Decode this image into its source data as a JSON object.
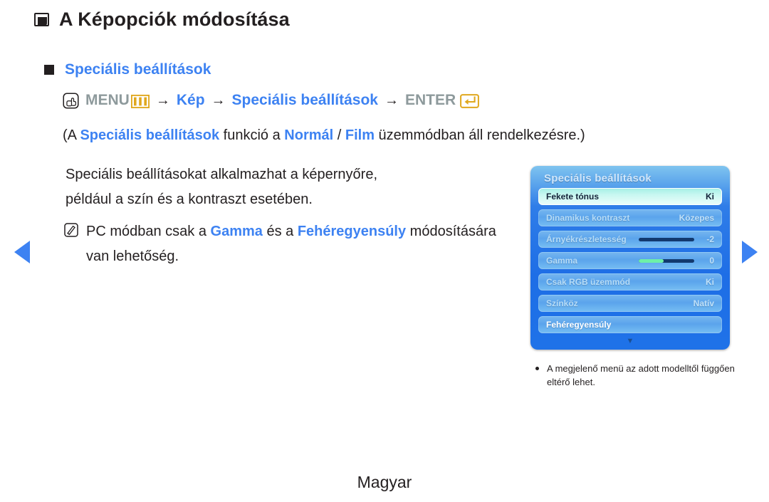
{
  "page_title": {
    "bullet_icon": "square-outline-bullet",
    "text": "A Képopciók módosítása"
  },
  "section": {
    "bullet_icon": "square-filled-bullet",
    "heading": "Speciális beállítások"
  },
  "menu_path": {
    "press_icon": "hand-press-button-icon",
    "menu_label": "MENU",
    "menu_icon": "menu-bars-icon",
    "arrow1": "→",
    "step_kep": "Kép",
    "arrow2": "→",
    "step_specialis": "Speciális beállítások",
    "arrow3": "→",
    "enter_label": "ENTER",
    "enter_icon": "enter-key-icon"
  },
  "availability": {
    "prefix": "(A ",
    "highlight1": "Speciális beállítások",
    "mid1": " funkció a ",
    "highlight2": "Normál",
    "mid2": " / ",
    "highlight3": "Film",
    "suffix": " üzemmódban áll rendelkezésre.)"
  },
  "body_paragraph": {
    "line1": "Speciális beállításokat alkalmazhat a képernyőre,",
    "line2": "például a szín és a kontraszt esetében."
  },
  "nn_note": {
    "icon": "note-nn-icon",
    "prefix": "PC módban csak a ",
    "highlight1": "Gamma",
    "mid": " és a ",
    "highlight2": "Fehéregyensúly",
    "suffix": " módosítására van lehetőség."
  },
  "navigation": {
    "prev_icon": "triangle-left-icon",
    "next_icon": "triangle-right-icon"
  },
  "osd": {
    "title": "Speciális beállítások",
    "rows": [
      {
        "label": "Fekete tónus",
        "value": "Ki",
        "type": "value",
        "state": "selected"
      },
      {
        "label": "Dinamikus kontraszt",
        "value": "Közepes",
        "type": "value",
        "state": "normal"
      },
      {
        "label": "Árnyékrészletesség",
        "value": "-2",
        "type": "slider",
        "fill_percent": 0,
        "state": "normal"
      },
      {
        "label": "Gamma",
        "value": "0",
        "type": "slider",
        "fill_percent": 45,
        "state": "normal"
      },
      {
        "label": "Csak RGB üzemmód",
        "value": "Ki",
        "type": "value",
        "state": "normal"
      },
      {
        "label": "Színköz",
        "value": "Natív",
        "type": "value",
        "state": "normal"
      },
      {
        "label": "Fehéregyensúly",
        "value": "",
        "type": "value",
        "state": "bright"
      }
    ],
    "scroll_down_icon": "chevron-down-icon",
    "caption": {
      "line1": "A megjelenő menü az adott modelltől",
      "line2": "függően eltérő lehet."
    }
  },
  "footer": {
    "language": "Magyar"
  },
  "colors": {
    "accent_blue": "#3d82f2",
    "gray_text": "#8e9a9c",
    "gold": "#e0a81e",
    "osd_blue": "#1e6ee6",
    "osd_selected": "#cdf6f0",
    "slider_green": "#6ef0a8",
    "body_text": "#231f20"
  }
}
